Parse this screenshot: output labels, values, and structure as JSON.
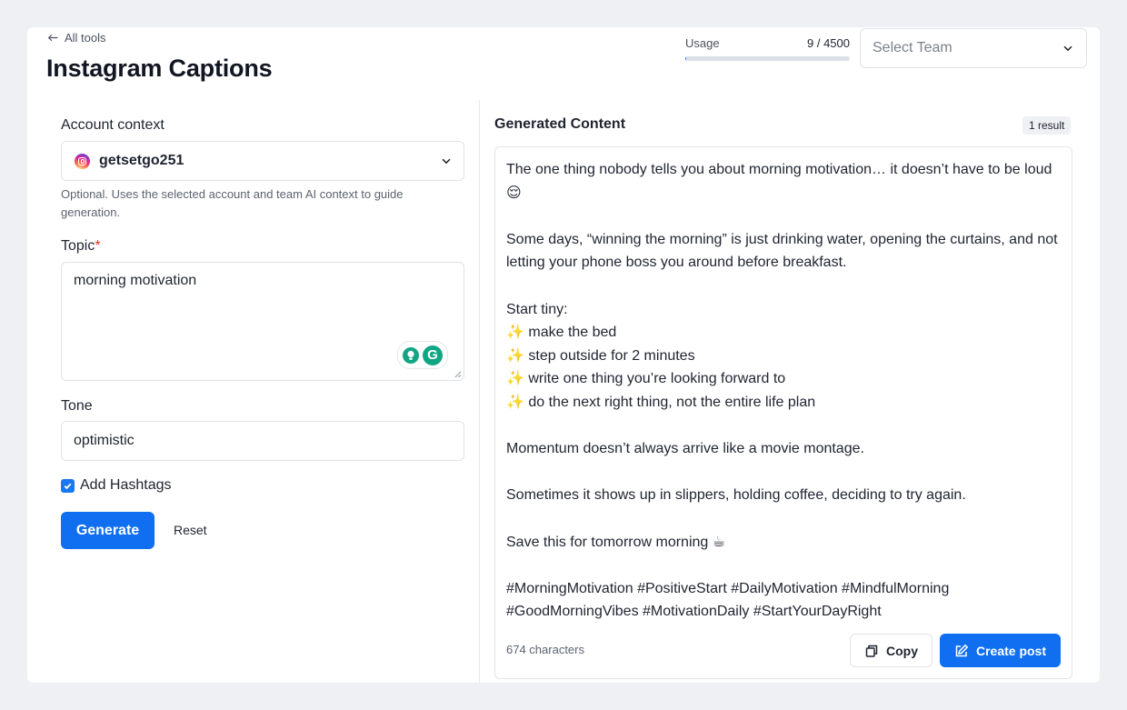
{
  "header": {
    "back_label": "All tools",
    "title": "Instagram Captions",
    "usage_label": "Usage",
    "usage_value": "9 / 4500",
    "usage_fraction": 0.002,
    "team_placeholder": "Select Team"
  },
  "form": {
    "account_label": "Account context",
    "account_value": "getsetgo251",
    "account_helper": "Optional. Uses the selected account and team AI context to guide generation.",
    "topic_label": "Topic",
    "topic_required": "*",
    "topic_value": "morning motivation",
    "tone_label": "Tone",
    "tone_value": "optimistic",
    "hashtags_label": "Add Hashtags",
    "hashtags_checked": true,
    "generate_label": "Generate",
    "reset_label": "Reset"
  },
  "output": {
    "title": "Generated Content",
    "result_badge": "1 result",
    "lines": [
      "The one thing nobody tells you about morning motivation… it doesn’t have to be loud 😌",
      "",
      "Some days, “winning the morning” is just drinking water, opening the curtains, and not letting your phone boss you around before breakfast.",
      "",
      "Start tiny:",
      "✨ make the bed",
      "✨ step outside for 2 minutes",
      "✨ write one thing you’re looking forward to",
      "✨ do the next right thing, not the entire life plan",
      "",
      "Momentum doesn’t always arrive like a movie montage.",
      "",
      "Sometimes it shows up in slippers, holding coffee, deciding to try again.",
      "",
      "Save this for tomorrow morning ☕",
      "",
      "#MorningMotivation #PositiveStart #DailyMotivation #MindfulMorning #GoodMorningVibes #MotivationDaily #StartYourDayRight"
    ],
    "char_count": "674 characters",
    "copy_label": "Copy",
    "create_label": "Create post"
  },
  "colors": {
    "primary": "#0f6ff0",
    "background": "#eff0f3",
    "required": "#e0322f",
    "grammarly": "#11a683"
  }
}
